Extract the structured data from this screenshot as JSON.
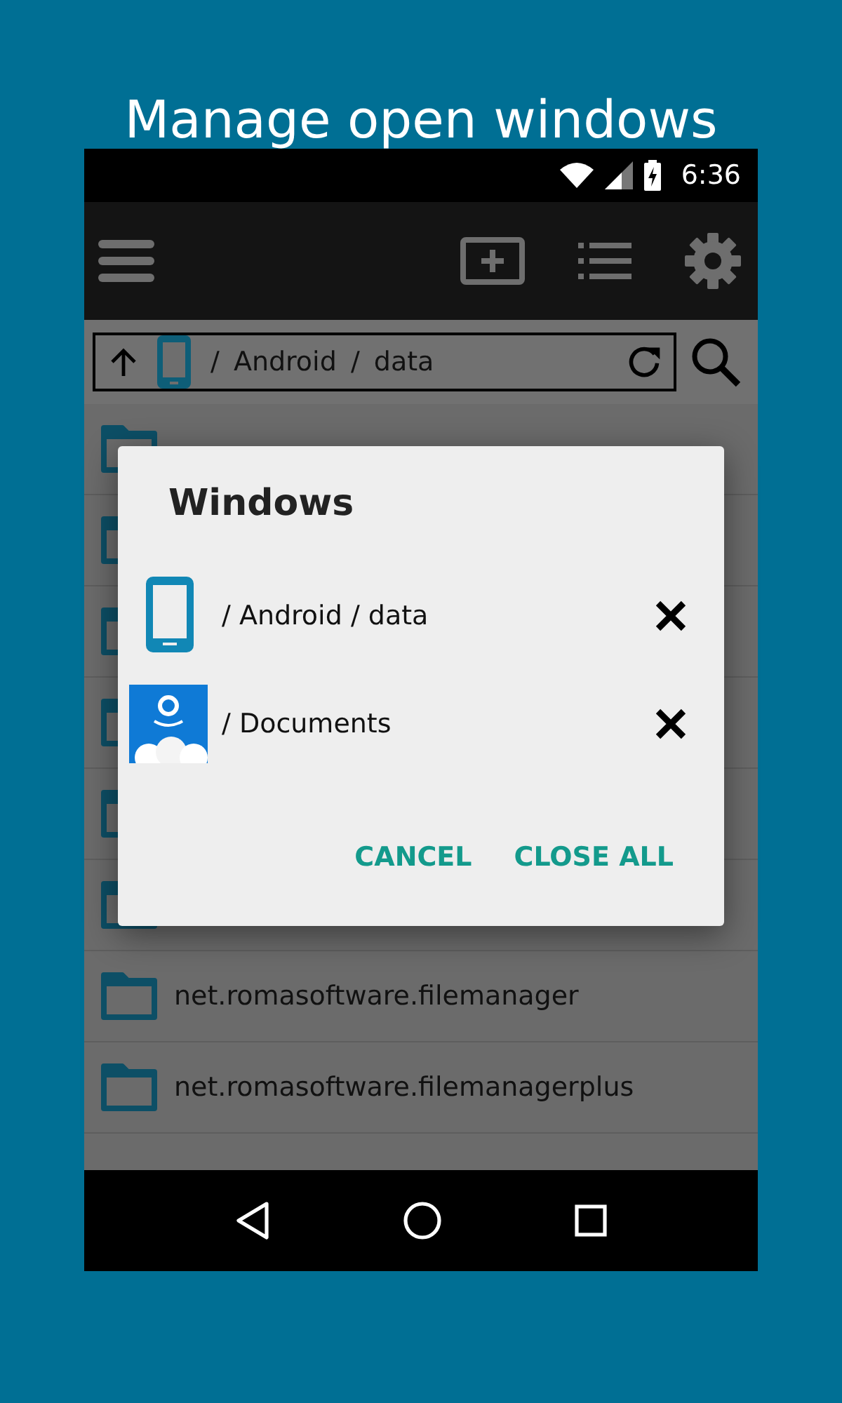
{
  "heading": "Manage open windows",
  "status_bar": {
    "time": "6:36"
  },
  "path_bar": {
    "path": "/ Android / data"
  },
  "folders": [
    {
      "name": "net.romasoftware.filemanager"
    },
    {
      "name": "net.romasoftware.filemanagerplus"
    }
  ],
  "dialog": {
    "title": "Windows",
    "windows": [
      {
        "path": "/ Android / data",
        "kind": "device"
      },
      {
        "path": "/ Documents",
        "kind": "cloud"
      }
    ],
    "buttons": [
      "CANCEL",
      "CLOSE ALL"
    ]
  }
}
